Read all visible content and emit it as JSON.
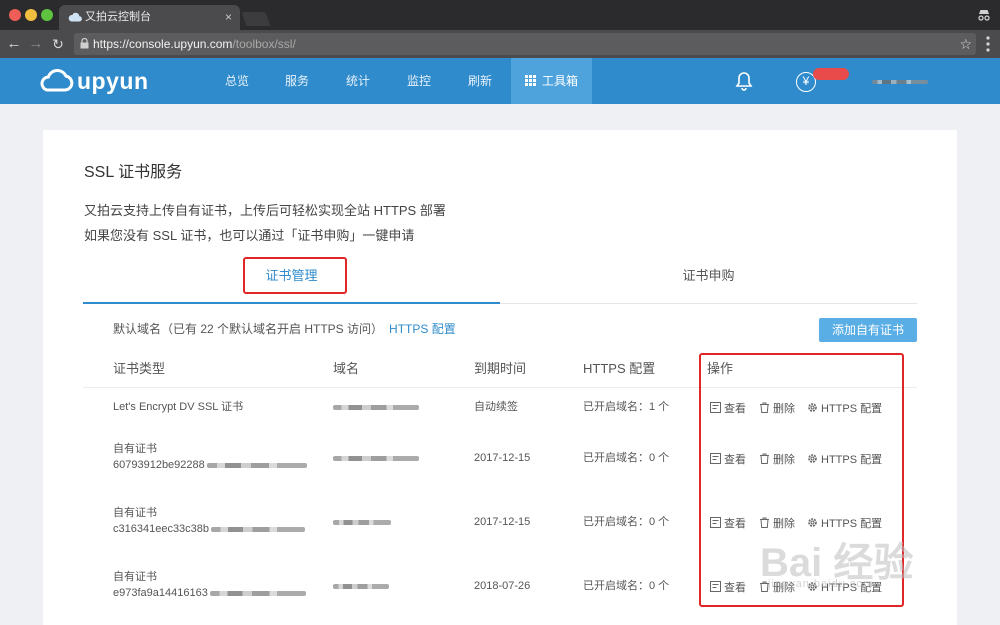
{
  "browser": {
    "tab_title": "又拍云控制台",
    "tab_close": "×",
    "url_scheme": "https://",
    "url_host": "console.upyun.com",
    "url_path": "/toolbox/ssl/"
  },
  "app": {
    "logo_text": "upyun",
    "nav": [
      {
        "label": "总览"
      },
      {
        "label": "服务"
      },
      {
        "label": "统计"
      },
      {
        "label": "监控"
      },
      {
        "label": "刷新"
      },
      {
        "label": "工具箱"
      }
    ],
    "active_nav": "工具箱",
    "yen_symbol": "¥"
  },
  "page": {
    "title": "SSL 证书服务",
    "desc1": "又拍云支持上传自有证书，上传后可轻松实现全站 HTTPS 部署",
    "desc2": "如果您没有 SSL 证书，也可以通过「证书申购」一键申请",
    "tabs": [
      {
        "label": "证书管理"
      },
      {
        "label": "证书申购"
      }
    ],
    "notice": "默认域名（已有 22 个默认域名开启 HTTPS 访问）",
    "notice_link": "HTTPS 配置",
    "add_button": "添加自有证书"
  },
  "table": {
    "headers": [
      "证书类型",
      "域名",
      "到期时间",
      "HTTPS 配置",
      "操作"
    ],
    "rows": [
      {
        "type": "Let's Encrypt DV SSL 证书",
        "id": "",
        "expiry": "自动续签",
        "https": "已开启域名：1 个"
      },
      {
        "type": "自有证书",
        "id": "60793912be92288",
        "expiry": "2017-12-15",
        "https": "已开启域名：0 个"
      },
      {
        "type": "自有证书",
        "id": "c316341eec33c38b",
        "expiry": "2017-12-15",
        "https": "已开启域名：0 个"
      },
      {
        "type": "自有证书",
        "id": "e973fa9a14416163",
        "expiry": "2018-07-26",
        "https": "已开启域名：0 个"
      }
    ],
    "action_view": "查看",
    "action_delete": "删除",
    "action_https": "HTTPS 配置"
  },
  "watermark": {
    "text": "Bai 经验",
    "sub": "jingyan.baidu.com"
  },
  "colors": {
    "brand": "#2f8bcb",
    "highlight": "#e02626"
  }
}
